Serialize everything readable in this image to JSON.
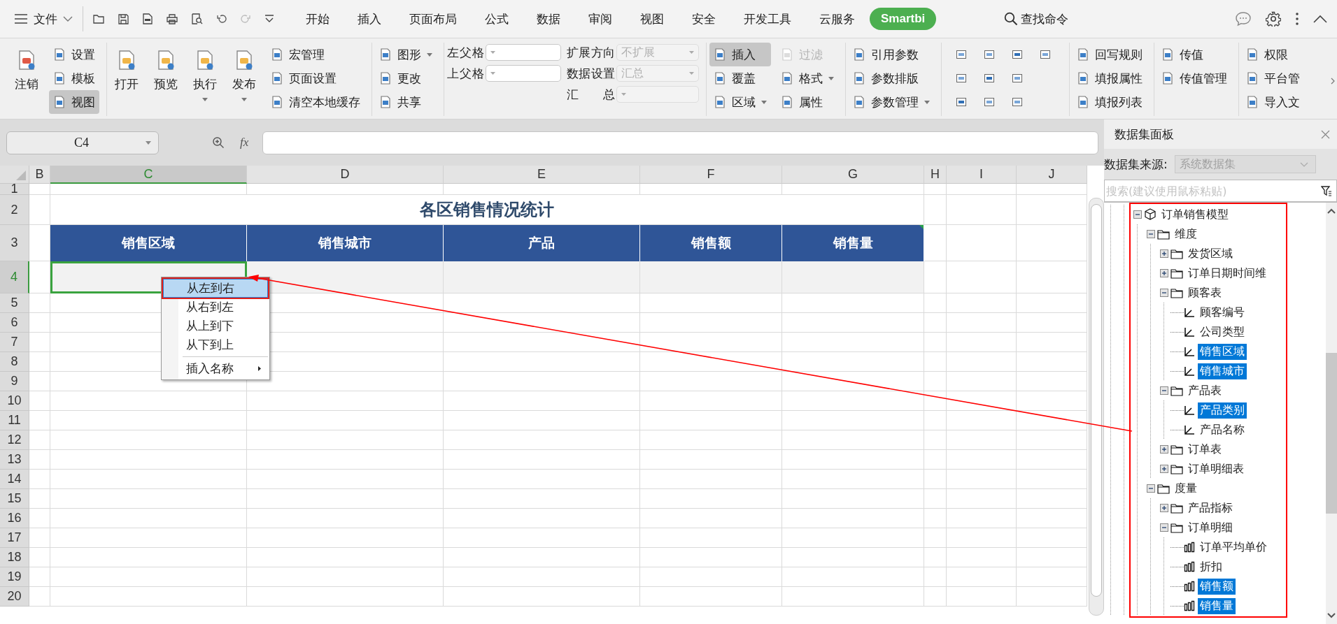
{
  "menu_bar": {
    "file_menu": "文件",
    "tabs": [
      {
        "label": "开始",
        "selected": false
      },
      {
        "label": "插入",
        "selected": false
      },
      {
        "label": "页面布局",
        "selected": false
      },
      {
        "label": "公式",
        "selected": false
      },
      {
        "label": "数据",
        "selected": false
      },
      {
        "label": "审阅",
        "selected": false
      },
      {
        "label": "视图",
        "selected": false
      },
      {
        "label": "安全",
        "selected": false
      },
      {
        "label": "开发工具",
        "selected": false
      },
      {
        "label": "云服务",
        "selected": false
      },
      {
        "label": "Smartbi",
        "selected": true
      }
    ],
    "search": "查找命令"
  },
  "ribbon": {
    "groups": [
      {
        "columns": [
          {
            "kind": "large",
            "items": [
              {
                "label": "注销",
                "dropdown": false,
                "pressed": false,
                "disabled": false
              }
            ]
          },
          {
            "kind": "stack",
            "items": [
              {
                "label": "设置",
                "dropdown": false,
                "pressed": false,
                "disabled": false
              },
              {
                "label": "模板",
                "dropdown": false,
                "pressed": false,
                "disabled": false
              },
              {
                "label": "视图",
                "dropdown": false,
                "pressed": true,
                "disabled": false
              }
            ]
          }
        ]
      },
      {
        "columns": [
          {
            "kind": "large",
            "items": [
              {
                "label": "打开",
                "dropdown": false,
                "pressed": false,
                "disabled": false
              }
            ]
          },
          {
            "kind": "large",
            "items": [
              {
                "label": "预览",
                "dropdown": false,
                "pressed": false,
                "disabled": false
              }
            ]
          },
          {
            "kind": "large",
            "items": [
              {
                "label": "执行",
                "dropdown": true,
                "pressed": false,
                "disabled": false
              }
            ]
          },
          {
            "kind": "large",
            "items": [
              {
                "label": "发布",
                "dropdown": true,
                "pressed": false,
                "disabled": false
              }
            ]
          },
          {
            "kind": "stack",
            "items": [
              {
                "label": "宏管理",
                "dropdown": false,
                "pressed": false,
                "disabled": false
              },
              {
                "label": "页面设置",
                "dropdown": false,
                "pressed": false,
                "disabled": false
              },
              {
                "label": "清空本地缓存",
                "dropdown": false,
                "pressed": false,
                "disabled": false
              }
            ]
          }
        ]
      },
      {
        "columns": [
          {
            "kind": "stack",
            "items": [
              {
                "label": "图形",
                "dropdown": true,
                "pressed": false,
                "disabled": false
              },
              {
                "label": "更改",
                "dropdown": false,
                "pressed": false,
                "disabled": false
              },
              {
                "label": "共享",
                "dropdown": false,
                "pressed": false,
                "disabled": false
              }
            ]
          }
        ]
      },
      {
        "columns": [
          {
            "kind": "fields",
            "fields": [
              {
                "label": "左父格",
                "disabled": false
              },
              {
                "label": "上父格",
                "disabled": false
              }
            ]
          },
          {
            "kind": "fields",
            "fields": [
              {
                "label": "扩展方向",
                "value": "不扩展",
                "disabled": true
              },
              {
                "label": "数据设置",
                "value": "汇总",
                "disabled": true
              },
              {
                "label": "汇 总",
                "disabled": true
              }
            ]
          }
        ]
      },
      {
        "columns": [
          {
            "kind": "stack",
            "items": [
              {
                "label": "插入",
                "dropdown": false,
                "pressed": true,
                "disabled": false
              },
              {
                "label": "覆盖",
                "dropdown": false,
                "pressed": false,
                "disabled": false
              },
              {
                "label": "区域",
                "dropdown": true,
                "pressed": false,
                "disabled": false
              }
            ]
          },
          {
            "kind": "stack",
            "items": [
              {
                "label": "过滤",
                "dropdown": false,
                "pressed": false,
                "disabled": true
              },
              {
                "label": "格式",
                "dropdown": true,
                "pressed": false,
                "disabled": false
              },
              {
                "label": "属性",
                "dropdown": false,
                "pressed": false,
                "disabled": false
              }
            ]
          }
        ]
      },
      {
        "columns": [
          {
            "kind": "stack",
            "items": [
              {
                "label": "引用参数",
                "dropdown": false,
                "pressed": false,
                "disabled": false
              },
              {
                "label": "参数排版",
                "dropdown": false,
                "pressed": false,
                "disabled": false
              },
              {
                "label": "参数管理",
                "dropdown": true,
                "pressed": false,
                "disabled": false
              }
            ]
          }
        ]
      },
      {
        "columns": [
          {
            "kind": "icon_grid"
          }
        ]
      },
      {
        "columns": [
          {
            "kind": "stack",
            "items": [
              {
                "label": "回写规则",
                "dropdown": false,
                "pressed": false,
                "disabled": false
              },
              {
                "label": "填报属性",
                "dropdown": false,
                "pressed": false,
                "disabled": false
              },
              {
                "label": "填报列表",
                "dropdown": false,
                "pressed": false,
                "disabled": false
              }
            ]
          }
        ]
      },
      {
        "columns": [
          {
            "kind": "stack",
            "items": [
              {
                "label": "传值",
                "dropdown": false,
                "pressed": false,
                "disabled": false
              },
              {
                "label": "传值管理",
                "dropdown": false,
                "pressed": false,
                "disabled": false
              }
            ]
          }
        ]
      },
      {
        "columns": [
          {
            "kind": "stack",
            "items": [
              {
                "label": "权限",
                "dropdown": false,
                "pressed": false,
                "disabled": false
              },
              {
                "label": "平台管",
                "dropdown": false,
                "pressed": false,
                "disabled": false
              },
              {
                "label": "导入文",
                "dropdown": false,
                "pressed": false,
                "disabled": false
              }
            ]
          }
        ]
      }
    ]
  },
  "formula_bar": {
    "cell_ref": "C4",
    "fx": "fx"
  },
  "sheet": {
    "columns": [
      {
        "label": "B",
        "selected": false
      },
      {
        "label": "C",
        "selected": true
      },
      {
        "label": "D",
        "selected": false
      },
      {
        "label": "E",
        "selected": false
      },
      {
        "label": "F",
        "selected": false
      },
      {
        "label": "G",
        "selected": false
      },
      {
        "label": "H",
        "selected": false
      },
      {
        "label": "I",
        "selected": false
      },
      {
        "label": "J",
        "selected": false
      }
    ],
    "rows": [
      {
        "label": "1",
        "selected": false
      },
      {
        "label": "2",
        "selected": false
      },
      {
        "label": "3",
        "selected": false
      },
      {
        "label": "4",
        "selected": true
      },
      {
        "label": "5",
        "selected": false
      },
      {
        "label": "6",
        "selected": false
      },
      {
        "label": "7",
        "selected": false
      },
      {
        "label": "8",
        "selected": false
      },
      {
        "label": "9",
        "selected": false
      },
      {
        "label": "10",
        "selected": false
      },
      {
        "label": "11",
        "selected": false
      },
      {
        "label": "12",
        "selected": false
      },
      {
        "label": "13",
        "selected": false
      },
      {
        "label": "14",
        "selected": false
      },
      {
        "label": "15",
        "selected": false
      },
      {
        "label": "16",
        "selected": false
      },
      {
        "label": "17",
        "selected": false
      },
      {
        "label": "18",
        "selected": false
      },
      {
        "label": "19",
        "selected": false
      },
      {
        "label": "20",
        "selected": false
      }
    ],
    "title": "各区销售情况统计",
    "headers": [
      "销售区域",
      "销售城市",
      "产品",
      "销售额",
      "销售量"
    ]
  },
  "context_menu": {
    "items": [
      {
        "label": "从左到右",
        "kind": "item",
        "selected": true
      },
      {
        "label": "从右到左",
        "kind": "item",
        "selected": false
      },
      {
        "label": "从上到下",
        "kind": "item",
        "selected": false
      },
      {
        "label": "从下到上",
        "kind": "item",
        "selected": false
      },
      {
        "label": "插入名称",
        "kind": "submenu",
        "selected": false
      }
    ]
  },
  "panel": {
    "title": "数据集面板",
    "source_label": "数据集来源:",
    "source_value": "系统数据集",
    "search_placeholder": "搜索(建议使用鼠标粘贴)",
    "tree": [
      {
        "label": "订单销售模型",
        "kind": "model",
        "expanded": true,
        "children": [
          {
            "label": "维度",
            "kind": "folder",
            "expanded": true,
            "children": [
              {
                "label": "发货区域",
                "kind": "folder",
                "expanded": false
              },
              {
                "label": "订单日期时间维",
                "kind": "folder",
                "expanded": false
              },
              {
                "label": "顾客表",
                "kind": "folder",
                "expanded": true,
                "children": [
                  {
                    "label": "顾客编号",
                    "kind": "dimension",
                    "selected": false
                  },
                  {
                    "label": "公司类型",
                    "kind": "dimension",
                    "selected": false
                  },
                  {
                    "label": "销售区域",
                    "kind": "dimension",
                    "selected": true
                  },
                  {
                    "label": "销售城市",
                    "kind": "dimension",
                    "selected": true
                  }
                ]
              },
              {
                "label": "产品表",
                "kind": "folder",
                "expanded": true,
                "children": [
                  {
                    "label": "产品类别",
                    "kind": "dimension",
                    "selected": true
                  },
                  {
                    "label": "产品名称",
                    "kind": "dimension",
                    "selected": false
                  }
                ]
              },
              {
                "label": "订单表",
                "kind": "folder",
                "expanded": false
              },
              {
                "label": "订单明细表",
                "kind": "folder",
                "expanded": false
              }
            ]
          },
          {
            "label": "度量",
            "kind": "folder",
            "expanded": true,
            "children": [
              {
                "label": "产品指标",
                "kind": "folder",
                "expanded": false
              },
              {
                "label": "订单明细",
                "kind": "folder",
                "expanded": true,
                "children": [
                  {
                    "label": "订单平均单价",
                    "kind": "measure",
                    "selected": false
                  },
                  {
                    "label": "折扣",
                    "kind": "measure",
                    "selected": false
                  },
                  {
                    "label": "销售额",
                    "kind": "measure",
                    "selected": true
                  },
                  {
                    "label": "销售量",
                    "kind": "measure",
                    "selected": true
                  }
                ]
              }
            ]
          }
        ]
      }
    ]
  }
}
